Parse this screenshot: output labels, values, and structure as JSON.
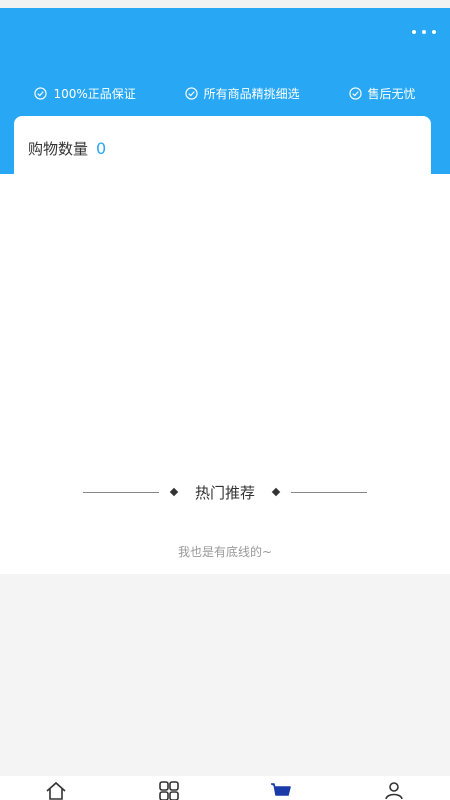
{
  "header": {
    "more_icon": "more-dots-icon",
    "guarantees": [
      {
        "icon": "check-circle-icon",
        "label": "100%正品保证"
      },
      {
        "icon": "check-circle-icon",
        "label": "所有商品精挑细选"
      },
      {
        "icon": "check-circle-icon",
        "label": "售后无忧"
      }
    ]
  },
  "cart": {
    "label": "购物数量",
    "count": "0"
  },
  "hot": {
    "title": "热门推荐"
  },
  "footer_note": "我也是有底线的~",
  "tabbar": {
    "tabs": [
      {
        "icon": "home-icon"
      },
      {
        "icon": "category-icon"
      },
      {
        "icon": "cart-icon",
        "active": true
      },
      {
        "icon": "user-icon"
      }
    ]
  },
  "colors": {
    "accent": "#28a8f4",
    "active_tab": "#1a3aa8",
    "background_gray": "#f4f4f4"
  }
}
